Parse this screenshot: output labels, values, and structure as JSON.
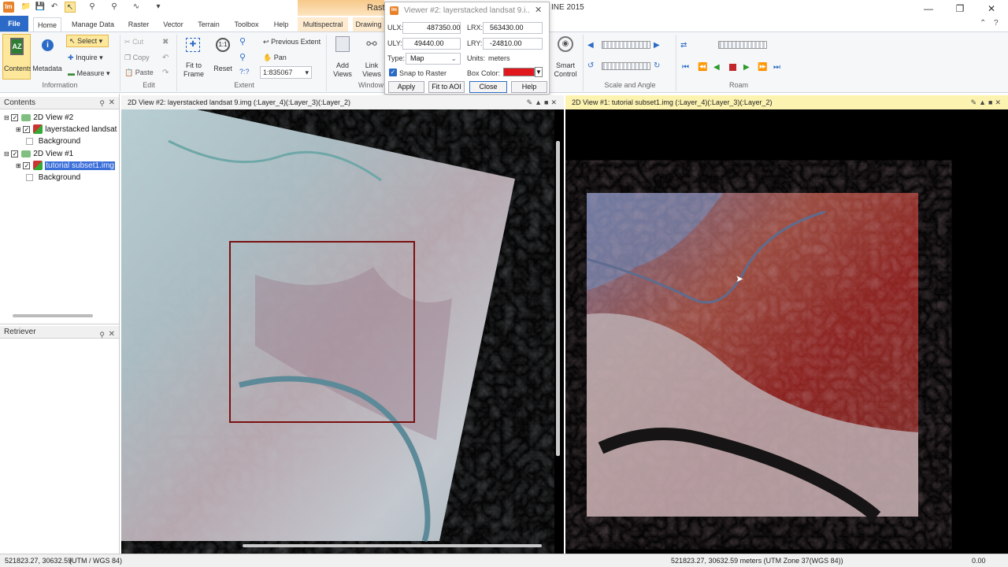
{
  "app": {
    "logo": "Im",
    "title_suffix": "INE 2015",
    "raster_tab_fragment": "Raste"
  },
  "tabs": [
    "File",
    "Home",
    "Manage Data",
    "Raster",
    "Vector",
    "Terrain",
    "Toolbox",
    "Help",
    "Multispectral",
    "Drawing"
  ],
  "ribbon": {
    "contents": "Contents",
    "metadata": "Metadata",
    "select": "Select",
    "inquire": "Inquire",
    "measure": "Measure",
    "cut": "Cut",
    "copy": "Copy",
    "paste": "Paste",
    "fit_to_frame": [
      "Fit to",
      "Frame"
    ],
    "reset": "Reset",
    "previous_extent": "Previous Extent",
    "pan": "Pan",
    "zoom_unknown": "?:?",
    "scale_value": "1:835067",
    "add_views": [
      "Add",
      "Views"
    ],
    "link_views": [
      "Link",
      "Views"
    ],
    "smart_control": [
      "Smart",
      "Control"
    ],
    "groups": {
      "information": "Information",
      "edit": "Edit",
      "extent": "Extent",
      "window": "Window",
      "scale_angle": "Scale and Angle",
      "roam": "Roam"
    }
  },
  "dialog": {
    "title": "Viewer #2: layerstacked landsat 9.i...",
    "ulx_label": "ULX:",
    "ulx": "487350.00",
    "lrx_label": "LRX:",
    "lrx": "563430.00",
    "uly_label": "ULY:",
    "uly": "49440.00",
    "lry_label": "LRY:",
    "lry": "-24810.00",
    "type_label": "Type:",
    "type": "Map",
    "units_label": "Units:",
    "units": "meters",
    "snap_label": "Snap to Raster",
    "box_color_label": "Box Color:",
    "box_color": "#e0181e",
    "apply": "Apply",
    "fit_aoi": "Fit to AOI",
    "close": "Close",
    "help": "Help"
  },
  "contents_pane": {
    "title": "Contents",
    "tree": [
      {
        "label": "2D View #2"
      },
      {
        "label": "layerstacked landsat"
      },
      {
        "label": "Background"
      },
      {
        "label": "2D View #1"
      },
      {
        "label": "tutorial subset1.img"
      },
      {
        "label": "Background"
      }
    ]
  },
  "retriever_pane": {
    "title": "Retriever"
  },
  "view2": {
    "title": "2D View #2: layerstacked landsat 9.img (:Layer_4)(:Layer_3)(:Layer_2)"
  },
  "view1": {
    "title": "2D View #1: tutorial subset1.img (:Layer_4)(:Layer_3)(:Layer_2)"
  },
  "status": {
    "left": "521823.27, 30632.59",
    "left_crs": "(UTM / WGS 84)",
    "right": "521823.27, 30632.59 meters (UTM Zone 37(WGS 84))",
    "far_right": "0.00"
  },
  "colors": {
    "accent": "#2b6bc7",
    "view1_header": "#fdf3b0",
    "aoi_box": "#7a1010"
  }
}
